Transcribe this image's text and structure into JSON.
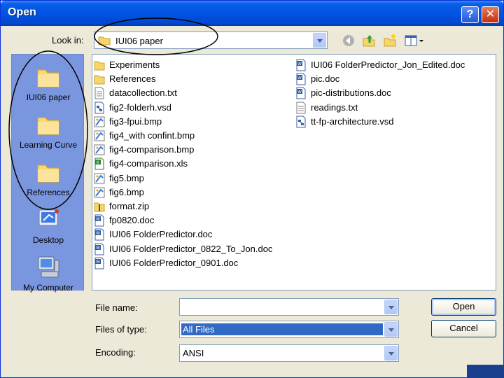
{
  "window": {
    "title": "Open",
    "help_glyph": "?",
    "close_glyph": "✕"
  },
  "toolbar": {
    "lookin_label": "Look in:",
    "lookin_value": "IUI06 paper",
    "icons": [
      "back-icon",
      "up-folder-icon",
      "new-folder-icon",
      "views-menu-icon"
    ]
  },
  "places": [
    {
      "label": "IUI06 paper",
      "icon": "folder-icon"
    },
    {
      "label": "Learning Curve",
      "icon": "folder-icon"
    },
    {
      "label": "References",
      "icon": "folder-icon"
    },
    {
      "label": "Desktop",
      "icon": "desktop-icon"
    },
    {
      "label": "My Computer",
      "icon": "computer-icon"
    }
  ],
  "files": {
    "col1": [
      {
        "name": "Experiments",
        "type": "folder"
      },
      {
        "name": "References",
        "type": "folder"
      },
      {
        "name": "datacollection.txt",
        "type": "txt"
      },
      {
        "name": "fig2-folderh.vsd",
        "type": "vsd"
      },
      {
        "name": "fig3-fpui.bmp",
        "type": "bmp"
      },
      {
        "name": "fig4_with confint.bmp",
        "type": "bmp"
      },
      {
        "name": "fig4-comparison.bmp",
        "type": "bmp"
      },
      {
        "name": "fig4-comparison.xls",
        "type": "xls"
      },
      {
        "name": "fig5.bmp",
        "type": "bmp"
      },
      {
        "name": "fig6.bmp",
        "type": "bmp"
      },
      {
        "name": "format.zip",
        "type": "zip"
      },
      {
        "name": "fp0820.doc",
        "type": "doc"
      },
      {
        "name": "IUI06 FolderPredictor.doc",
        "type": "doc"
      },
      {
        "name": "IUI06 FolderPredictor_0822_To_Jon.doc",
        "type": "doc"
      },
      {
        "name": "IUI06 FolderPredictor_0901.doc",
        "type": "doc"
      }
    ],
    "col2": [
      {
        "name": "IUI06 FolderPredictor_Jon_Edited.doc",
        "type": "doc"
      },
      {
        "name": "pic.doc",
        "type": "doc"
      },
      {
        "name": "pic-distributions.doc",
        "type": "doc"
      },
      {
        "name": "readings.txt",
        "type": "txt"
      },
      {
        "name": "tt-fp-architecture.vsd",
        "type": "vsd"
      }
    ]
  },
  "form": {
    "filename_label": "File name:",
    "filename_value": "",
    "filetype_label": "Files of type:",
    "filetype_value": "All Files",
    "encoding_label": "Encoding:",
    "encoding_value": "ANSI"
  },
  "buttons": {
    "open": "Open",
    "cancel": "Cancel"
  },
  "colors": {
    "titlebar": "#0054e3",
    "places_bar": "#7a96df",
    "selection": "#316ac5",
    "dialog_bg": "#ece9d8"
  }
}
